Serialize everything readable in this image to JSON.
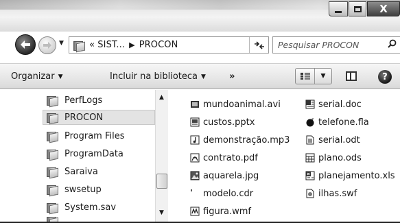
{
  "window": {
    "minimize_icon": "minimize-icon",
    "maximize_icon": "maximize-icon",
    "close_label": "X"
  },
  "address_bar": {
    "overflow": "«",
    "crumbs": [
      "SIST...",
      "PROCON"
    ],
    "refresh_icon": "refresh-icon",
    "search_placeholder": "Pesquisar PROCON"
  },
  "toolbar": {
    "organize_label": "Organizar",
    "include_label": "Incluir na biblioteca",
    "more_label": "»",
    "view_icon": "views-icon",
    "preview_icon": "preview-pane-icon",
    "help_label": "?"
  },
  "nav_pane": {
    "items": [
      {
        "label": "PerfLogs",
        "selected": false
      },
      {
        "label": "PROCON",
        "selected": true
      },
      {
        "label": "Program Files",
        "selected": false
      },
      {
        "label": "ProgramData",
        "selected": false
      },
      {
        "label": "Saraiva",
        "selected": false
      },
      {
        "label": "swsetup",
        "selected": false
      },
      {
        "label": "System.sav",
        "selected": false
      },
      {
        "label": "...",
        "selected": false
      }
    ]
  },
  "files": {
    "col1": [
      {
        "name": "mundoanimal.avi",
        "icon": "video-file-icon"
      },
      {
        "name": "custos.pptx",
        "icon": "presentation-file-icon"
      },
      {
        "name": "demonstração.mp3",
        "icon": "audio-file-icon"
      },
      {
        "name": "contrato.pdf",
        "icon": "pdf-file-icon"
      },
      {
        "name": "aquarela.jpg",
        "icon": "image-file-icon"
      },
      {
        "name": "modelo.cdr",
        "icon": "blank-file-icon"
      },
      {
        "name": "figura.wmf",
        "icon": "wmf-file-icon"
      }
    ],
    "col2": [
      {
        "name": "serial.doc",
        "icon": "word-file-icon"
      },
      {
        "name": "telefone.fla",
        "icon": "flash-file-icon"
      },
      {
        "name": "serial.odt",
        "icon": "text-document-icon"
      },
      {
        "name": "plano.ods",
        "icon": "spreadsheet-file-icon"
      },
      {
        "name": "planejamento.xls",
        "icon": "excel-file-icon"
      },
      {
        "name": "ilhas.swf",
        "icon": "swf-file-icon"
      }
    ]
  }
}
